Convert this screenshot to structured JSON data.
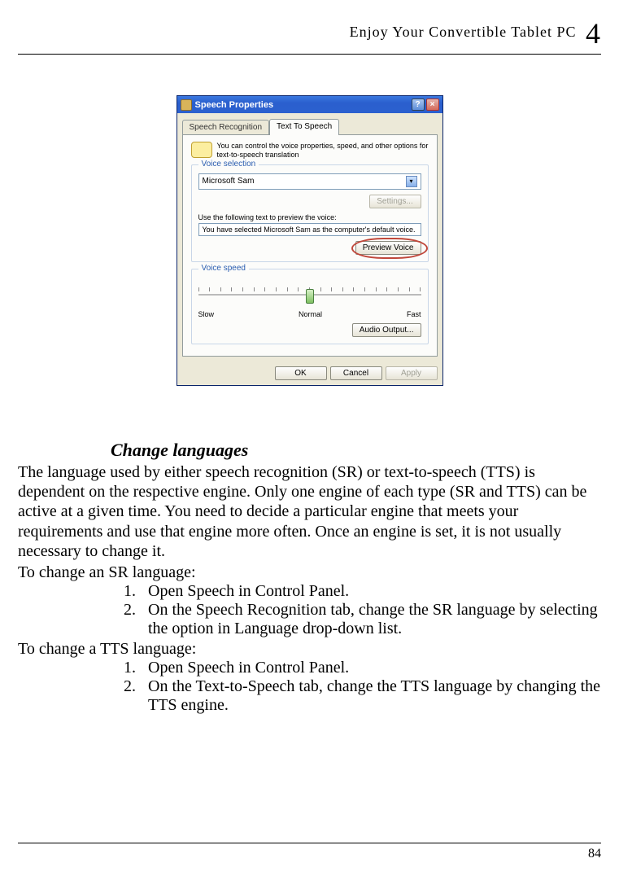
{
  "header": {
    "title": "Enjoy  Your  Convertible  Tablet  PC",
    "chapter": "4"
  },
  "dialog": {
    "title": "Speech Properties",
    "help_label": "?",
    "close_label": "×",
    "tabs": {
      "inactive": "Speech Recognition",
      "active": "Text To Speech"
    },
    "intro": "You can control the voice properties, speed, and other options for text-to-speech translation",
    "voice_selection": {
      "title": "Voice selection",
      "selected": "Microsoft Sam",
      "settings_btn": "Settings...",
      "preview_label": "Use the following text to preview the voice:",
      "preview_text": "You have selected Microsoft Sam as the computer's default voice.",
      "preview_btn": "Preview Voice"
    },
    "voice_speed": {
      "title": "Voice speed",
      "slow": "Slow",
      "normal": "Normal",
      "fast": "Fast",
      "audio_btn": "Audio Output..."
    },
    "buttons": {
      "ok": "OK",
      "cancel": "Cancel",
      "apply": "Apply"
    }
  },
  "section": {
    "heading": "Change languages",
    "paragraph": "The language used by either speech recognition (SR) or text-to-speech (TTS) is dependent on the respective engine.    Only one engine of each type (SR and TTS) can be active at a given time. You need to decide a particular engine that meets your requirements and use that engine more often. Once an engine is set, it is not usually necessary to change it.",
    "sr_intro": "To change an SR language:",
    "sr_steps": [
      "Open Speech in Control Panel.",
      "On the Speech Recognition tab, change the SR language by selecting the option in Language drop-down list."
    ],
    "tts_intro": "To change a TTS language:",
    "tts_steps": [
      "Open Speech in Control Panel.",
      "On the Text-to-Speech tab, change the TTS language by changing the TTS engine."
    ]
  },
  "page_number": "84"
}
